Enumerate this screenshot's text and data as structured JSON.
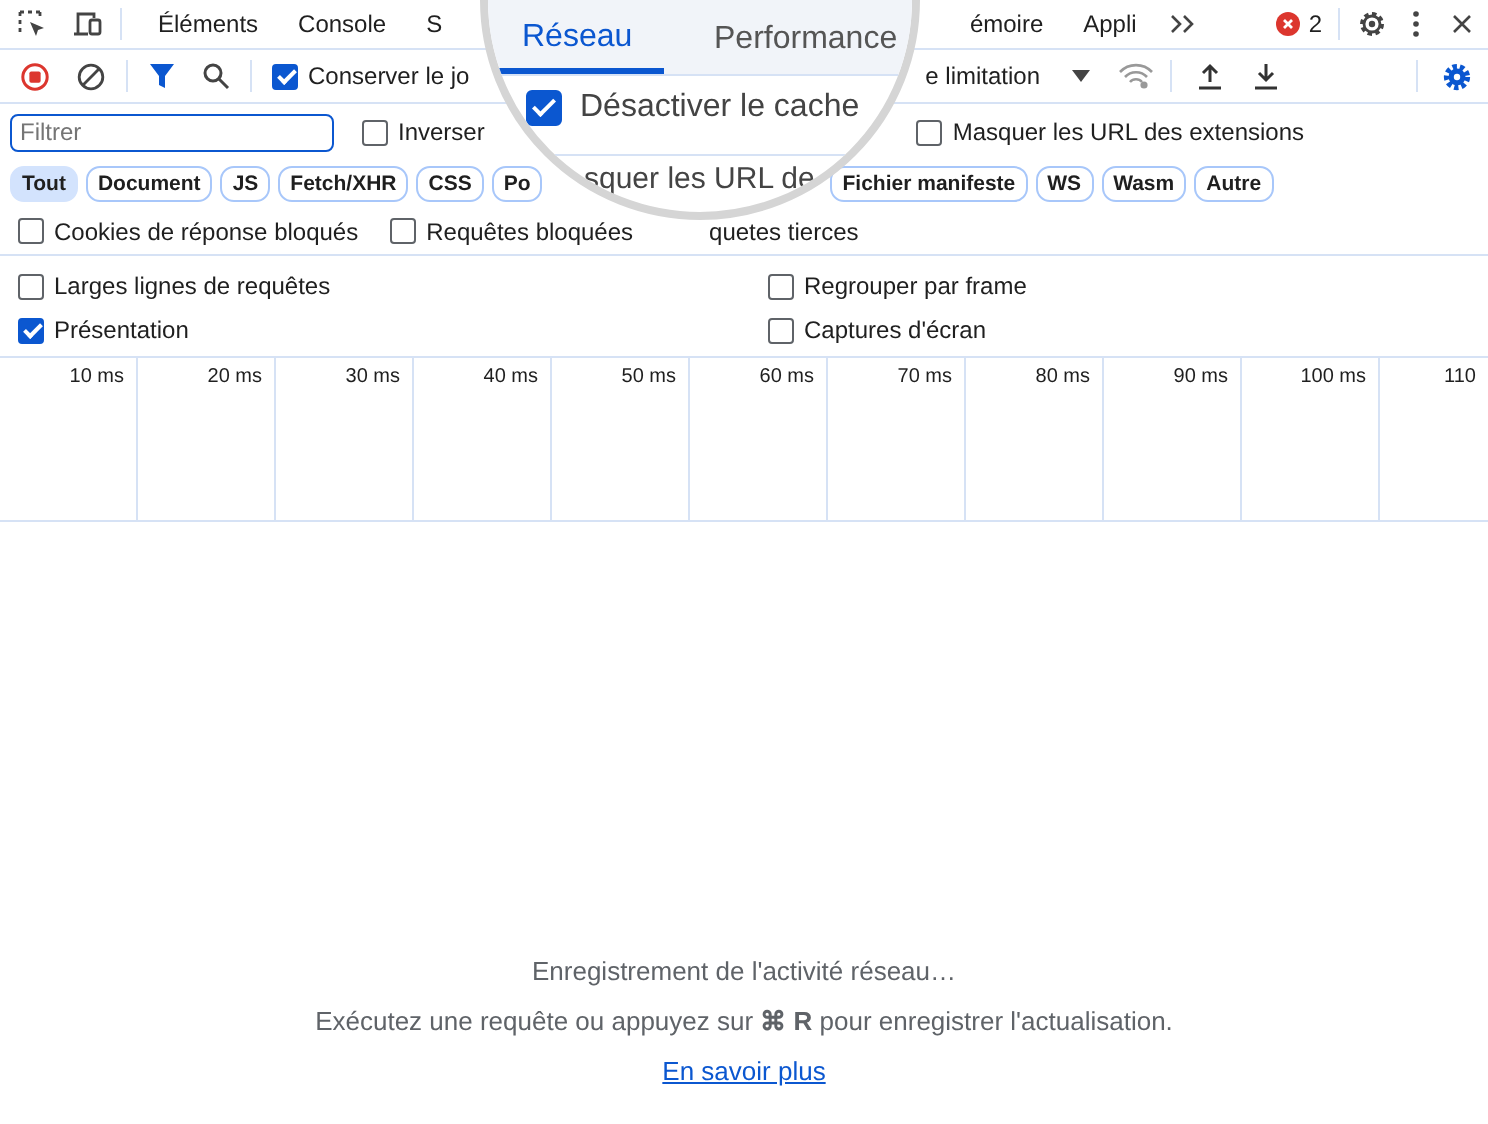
{
  "main_tabs_left": [
    {
      "label": "Éléments",
      "selected": false
    },
    {
      "label": "Console",
      "selected": false
    },
    {
      "label": "S",
      "selected": false
    }
  ],
  "main_tabs_right": [
    {
      "label": "émoire",
      "selected": false
    },
    {
      "label": "Appli",
      "selected": false
    }
  ],
  "error_count": "2",
  "toolbar": {
    "preserve_log": {
      "label": "Conserver le jo",
      "checked": true
    },
    "throttling": "e limitation"
  },
  "filter": {
    "placeholder": "Filtrer",
    "invert": {
      "label": "Inverser",
      "checked": false
    },
    "hide_extensions": {
      "label": "Masquer les URL des extensions",
      "checked": false
    }
  },
  "type_filters": [
    {
      "label": "Tout",
      "selected": true
    },
    {
      "label": "Document",
      "selected": false
    },
    {
      "label": "JS",
      "selected": false
    },
    {
      "label": "Fetch/XHR",
      "selected": false
    },
    {
      "label": "CSS",
      "selected": false
    },
    {
      "label": "Po",
      "selected": false
    },
    {
      "label": "Fichier manifeste",
      "selected": false
    },
    {
      "label": "WS",
      "selected": false
    },
    {
      "label": "Wasm",
      "selected": false
    },
    {
      "label": "Autre",
      "selected": false
    }
  ],
  "blocked_options": [
    {
      "label": "Cookies de réponse bloqués",
      "checked": false
    },
    {
      "label": "Requêtes bloquées",
      "checked": false
    }
  ],
  "third_party_text": "quetes tierces",
  "settings": [
    {
      "label": "Larges lignes de requêtes",
      "checked": false
    },
    {
      "label": "Regrouper par frame",
      "checked": false
    },
    {
      "label": "Présentation",
      "checked": true
    },
    {
      "label": "Captures d'écran",
      "checked": false
    }
  ],
  "timeline_ticks": [
    "10 ms",
    "20 ms",
    "30 ms",
    "40 ms",
    "50 ms",
    "60 ms",
    "70 ms",
    "80 ms",
    "90 ms",
    "100 ms",
    "110"
  ],
  "empty_state": {
    "title": "Enregistrement de l'activité réseau…",
    "hint": "Exécutez une requête ou appuyez sur **⌘ R** pour enregistrer l'actualisation.",
    "link": "En savoir plus"
  },
  "magnifier": {
    "tabs": [
      {
        "label": "Réseau",
        "selected": true
      },
      {
        "label": "Performance",
        "selected": false
      }
    ],
    "disable_cache": {
      "label": "Désactiver le cache",
      "checked": true
    },
    "text": "squer les URL de"
  }
}
